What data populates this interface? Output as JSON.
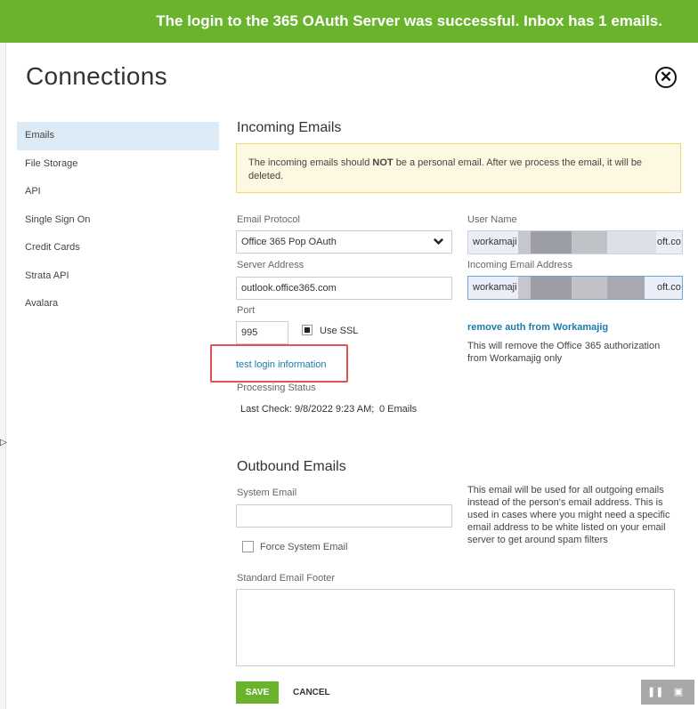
{
  "banner": {
    "message": "The login to the 365 OAuth Server was successful. Inbox has 1 emails."
  },
  "header": {
    "title": "Connections",
    "close_icon": "close-circle-icon"
  },
  "sidebar": {
    "items": [
      {
        "label": "Emails",
        "active": true
      },
      {
        "label": "File Storage"
      },
      {
        "label": "API"
      },
      {
        "label": "Single Sign On"
      },
      {
        "label": "Credit Cards"
      },
      {
        "label": "Strata API"
      },
      {
        "label": "Avalara"
      }
    ]
  },
  "incoming": {
    "heading": "Incoming Emails",
    "notice": {
      "before": "The incoming emails should ",
      "bold": "NOT",
      "after": " be a personal email. After we process the email, it will be deleted."
    },
    "protocol": {
      "label": "Email Protocol",
      "value": "Office 365 Pop OAuth"
    },
    "server": {
      "label": "Server Address",
      "value": "outlook.office365.com"
    },
    "port": {
      "label": "Port",
      "value": "995"
    },
    "ssl": {
      "label": "Use SSL",
      "checked": true
    },
    "test_link": "test login information",
    "status": {
      "label": "Processing Status",
      "last_check_label": "Last Check:",
      "last_check_value": "9/8/2022 9:23 AM;",
      "emails": "0 Emails"
    },
    "username": {
      "label": "User Name",
      "prefix": "workamaji",
      "suffix": "oft.co"
    },
    "incoming_address": {
      "label": "Incoming Email Address",
      "prefix": "workamaji",
      "suffix": "oft.co"
    },
    "remove_link": "remove auth from Workamajig",
    "remove_note": "This will remove the Office 365 authorization from Workamajig only"
  },
  "outbound": {
    "heading": "Outbound Emails",
    "system_email": {
      "label": "System Email",
      "value": ""
    },
    "force": {
      "label": "Force System Email",
      "checked": false
    },
    "footer": {
      "label": "Standard Email Footer",
      "value": ""
    },
    "note": "This email will be used for all outgoing emails instead of the person's email address. This is used in cases where you might need a specific email address to be white listed on your email server to get around spam filters"
  },
  "actions": {
    "save": "SAVE",
    "cancel": "CANCEL"
  },
  "colors": {
    "banner": "#6ab42d",
    "link": "#1a7ab0",
    "highlight": "#e05353",
    "active_nav": "#dcebf5"
  }
}
